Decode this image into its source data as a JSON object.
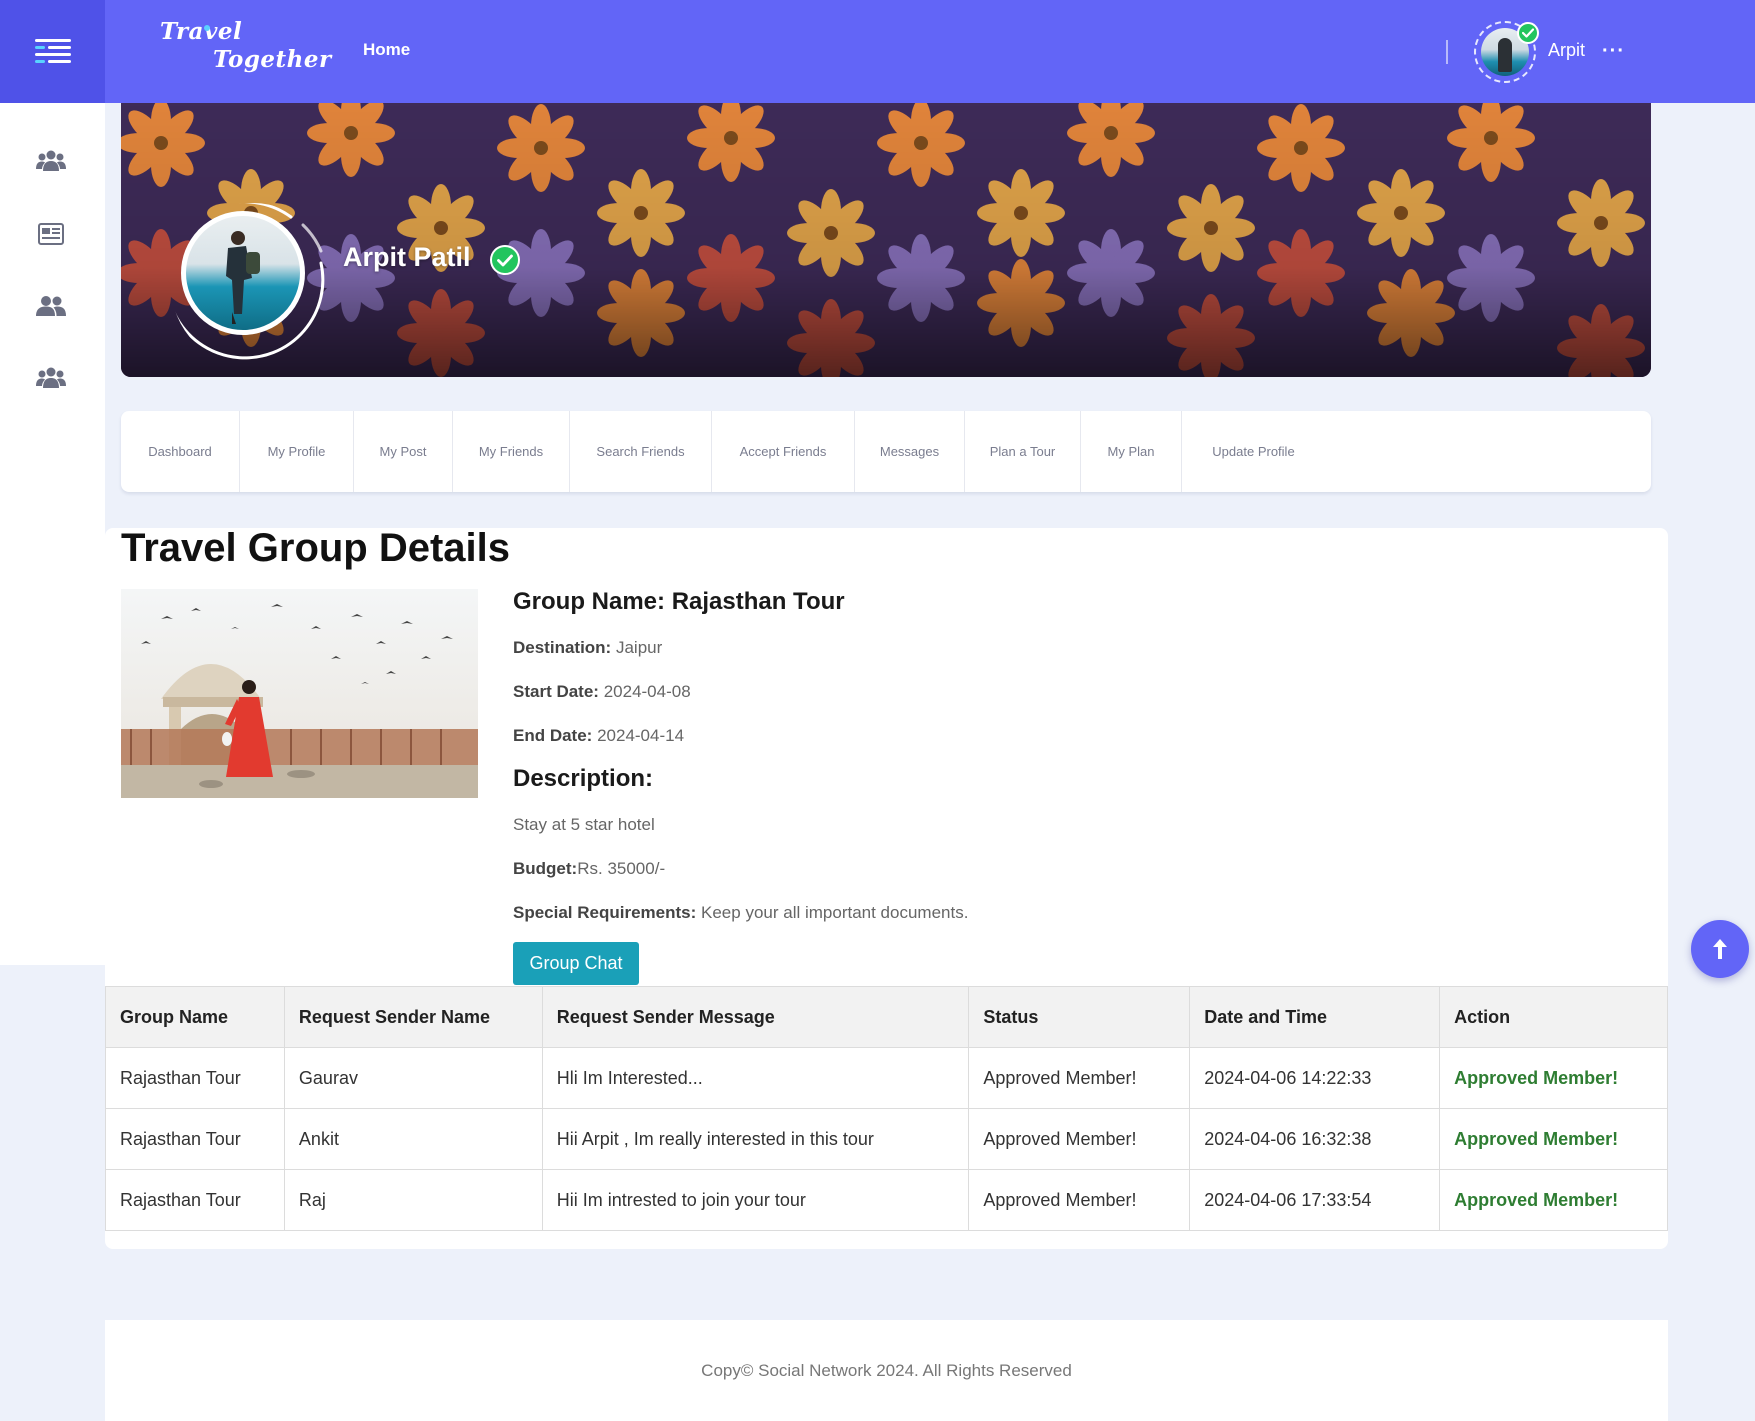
{
  "header": {
    "logo_line1": "Travel",
    "logo_line2": "Together",
    "home_label": "Home",
    "user_name": "Arpit",
    "more_label": "···",
    "brand_color": "#6265f7"
  },
  "sidebar": {
    "icons": [
      "groups-icon",
      "newspaper-icon",
      "users-icon",
      "groups-icon"
    ]
  },
  "profile": {
    "name": "Arpit Patil",
    "verified": true
  },
  "tabs": [
    {
      "label": "Dashboard"
    },
    {
      "label": "My Profile"
    },
    {
      "label": "My Post"
    },
    {
      "label": "My Friends"
    },
    {
      "label": "Search Friends"
    },
    {
      "label": "Accept Friends"
    },
    {
      "label": "Messages"
    },
    {
      "label": "Plan a Tour"
    },
    {
      "label": "My Plan"
    },
    {
      "label": "Update Profile"
    }
  ],
  "group": {
    "page_title": "Travel Group Details",
    "name_label": "Group Name:",
    "name": "Rajasthan Tour",
    "destination_label": "Destination:",
    "destination": "Jaipur",
    "start_label": "Start Date:",
    "start_date": "2024-04-08",
    "end_label": "End Date:",
    "end_date": "2024-04-14",
    "description_label": "Description:",
    "description": "Stay at 5 star hotel",
    "budget_label": "Budget:",
    "budget": "Rs. 35000/-",
    "special_label": "Special Requirements:",
    "special": "Keep your all important documents.",
    "chat_button": "Group Chat"
  },
  "table": {
    "headers": [
      "Group Name",
      "Request Sender Name",
      "Request Sender Message",
      "Status",
      "Date and Time",
      "Action"
    ],
    "rows": [
      [
        "Rajasthan Tour",
        "Gaurav",
        "Hli Im Interested...",
        "Approved Member!",
        "2024-04-06 14:22:33",
        "Approved Member!"
      ],
      [
        "Rajasthan Tour",
        "Ankit",
        "Hii Arpit , Im really interested in this tour",
        "Approved Member!",
        "2024-04-06 16:32:38",
        "Approved Member!"
      ],
      [
        "Rajasthan Tour",
        "Raj",
        "Hii Im intrested to join your tour",
        "Approved Member!",
        "2024-04-06 17:33:54",
        "Approved Member!"
      ]
    ]
  },
  "footer": {
    "text": "Copy© Social Network 2024. All Rights Reserved"
  }
}
